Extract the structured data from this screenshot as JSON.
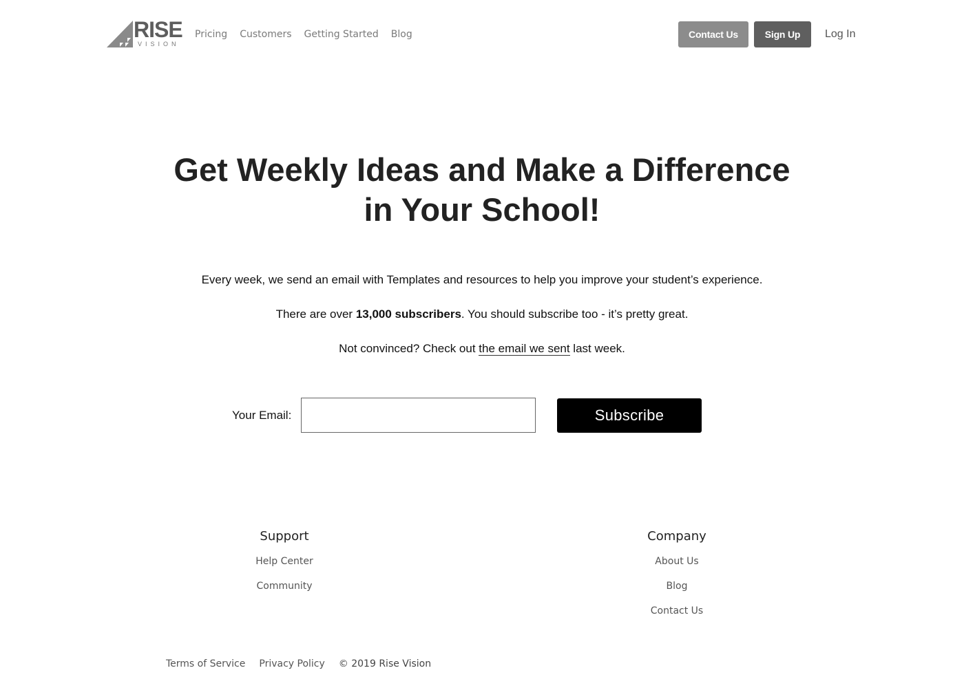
{
  "header": {
    "logo": {
      "word": "RISE",
      "sub": "VISION",
      "brand_color": "#5d5d5d"
    },
    "nav": [
      {
        "label": "Pricing"
      },
      {
        "label": "Customers"
      },
      {
        "label": "Getting Started"
      },
      {
        "label": "Blog"
      }
    ],
    "contact_label": "Contact Us",
    "signup_label": "Sign Up",
    "login_label": "Log In"
  },
  "hero": {
    "headline_line1": "Get Weekly Ideas and Make a Difference",
    "headline_line2": "in Your School!",
    "p1": "Every week, we send an email with Templates and resources to help you improve your student’s experience.",
    "p2_pre": "There are over ",
    "p2_bold": "13,000 subscribers",
    "p2_post": ". You should subscribe too - it’s pretty great.",
    "p3_pre": "Not convinced? Check out ",
    "p3_link": "the email we sent",
    "p3_post": " last week."
  },
  "form": {
    "email_label": "Your Email:",
    "email_value": "",
    "subscribe_label": "Subscribe"
  },
  "footer": {
    "support": {
      "heading": "Support",
      "links": [
        "Help Center",
        "Community"
      ]
    },
    "company": {
      "heading": "Company",
      "links": [
        "About Us",
        "Blog",
        "Contact Us"
      ]
    },
    "legal": {
      "terms": "Terms of Service",
      "privacy": "Privacy Policy",
      "copyright": "© 2019 Rise Vision"
    }
  }
}
